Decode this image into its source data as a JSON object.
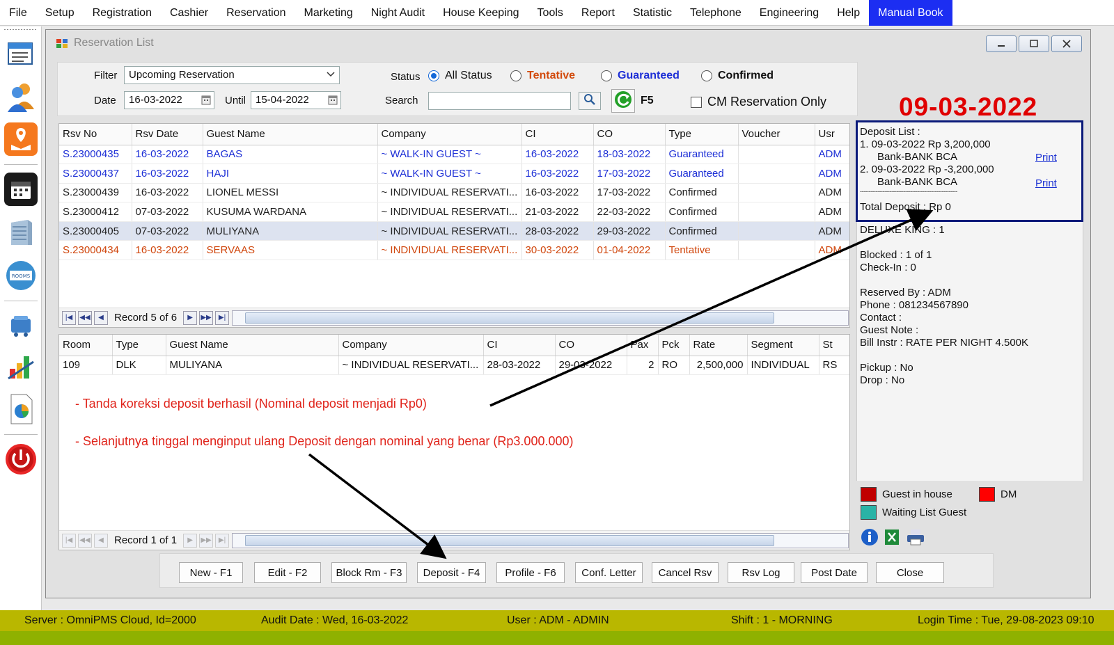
{
  "menu": [
    "File",
    "Setup",
    "Registration",
    "Cashier",
    "Reservation",
    "Marketing",
    "Night Audit",
    "House Keeping",
    "Tools",
    "Report",
    "Statistic",
    "Telephone",
    "Engineering",
    "Help",
    "Manual Book"
  ],
  "window": {
    "title": "Reservation List"
  },
  "filter": {
    "filter_label": "Filter",
    "filter_value": "Upcoming Reservation",
    "date_label": "Date",
    "date_value": "16-03-2022",
    "until_label": "Until",
    "until_value": "15-04-2022",
    "status_label": "Status",
    "status_options": [
      "All Status",
      "Tentative",
      "Guaranteed",
      "Confirmed"
    ],
    "status_selected": "All Status",
    "search_label": "Search",
    "search_value": "",
    "refresh_label": "F5",
    "cm_only_label": "CM Reservation Only"
  },
  "reservations": {
    "columns": [
      "Rsv No",
      "Rsv Date",
      "Guest Name",
      "Company",
      "CI",
      "CO",
      "Type",
      "Voucher",
      "Usr"
    ],
    "rows": [
      {
        "style": "blue",
        "cells": [
          "S.23000435",
          "16-03-2022",
          "BAGAS",
          "~ WALK-IN GUEST ~",
          "16-03-2022",
          "18-03-2022",
          "Guaranteed",
          "",
          "ADM"
        ]
      },
      {
        "style": "blue",
        "cells": [
          "S.23000437",
          "16-03-2022",
          "HAJI",
          "~ WALK-IN GUEST ~",
          "16-03-2022",
          "17-03-2022",
          "Guaranteed",
          "",
          "ADM"
        ]
      },
      {
        "style": "black",
        "cells": [
          "S.23000439",
          "16-03-2022",
          "LIONEL MESSI",
          "~ INDIVIDUAL RESERVATI...",
          "16-03-2022",
          "17-03-2022",
          "Confirmed",
          "",
          "ADM"
        ]
      },
      {
        "style": "black",
        "cells": [
          "S.23000412",
          "07-03-2022",
          "KUSUMA WARDANA",
          "~ INDIVIDUAL RESERVATI...",
          "21-03-2022",
          "22-03-2022",
          "Confirmed",
          "",
          "ADM"
        ]
      },
      {
        "style": "black sel",
        "cells": [
          "S.23000405",
          "07-03-2022",
          "MULIYANA",
          "~ INDIVIDUAL RESERVATI...",
          "28-03-2022",
          "29-03-2022",
          "Confirmed",
          "",
          "ADM"
        ]
      },
      {
        "style": "orange",
        "cells": [
          "S.23000434",
          "16-03-2022",
          "SERVAAS",
          "~ INDIVIDUAL RESERVATI...",
          "30-03-2022",
          "01-04-2022",
          "Tentative",
          "",
          "ADM"
        ]
      }
    ],
    "record_text": "Record 5 of 6"
  },
  "rooms": {
    "columns": [
      "Room",
      "Type",
      "Guest Name",
      "Company",
      "CI",
      "CO",
      "Pax",
      "Pck",
      "Rate",
      "Segment",
      "St"
    ],
    "rows": [
      {
        "cells": [
          "109",
          "DLK",
          "MULIYANA",
          "~ INDIVIDUAL RESERVATI...",
          "28-03-2022",
          "29-03-2022",
          "2",
          "RO",
          "2,500,000",
          "INDIVIDUAL",
          "RS"
        ]
      }
    ],
    "record_text": "Record 1 of 1"
  },
  "big_date": "09-03-2022",
  "deposit": {
    "title": "Deposit List :",
    "line1": "1. 09-03-2022   Rp 3,200,000",
    "line1b": "Bank-BANK BCA",
    "line2": "2. 09-03-2022   Rp -3,200,000",
    "line2b": "Bank-BANK BCA",
    "print_label": "Print",
    "dashes": "--------------------------------------------------------",
    "total": "Total Deposit : Rp 0"
  },
  "info": {
    "room_type": "DELUXE KING : 1",
    "blocked": "Blocked : 1 of 1",
    "checkin": "Check-In : 0",
    "reserved_by": "Reserved By : ADM",
    "phone": "Phone : 081234567890",
    "contact": "Contact :",
    "guest_note": "Guest Note :",
    "bill_instr": "Bill Instr : RATE PER NIGHT 4.500K",
    "pickup": "Pickup : No",
    "drop": "Drop : No"
  },
  "legend": {
    "guest_in_house": "Guest in house",
    "dm": "DM",
    "waiting_list": "Waiting List Guest",
    "colors": {
      "guest_in_house": "#c00000",
      "dm": "#ff0000",
      "waiting_list": "#2ab3a6"
    }
  },
  "annotations": {
    "note1": "- Tanda koreksi deposit berhasil (Nominal deposit menjadi Rp0)",
    "note2": "- Selanjutnya tinggal menginput ulang Deposit dengan nominal yang benar (Rp3.000.000)"
  },
  "buttons": [
    "New - F1",
    "Edit - F2",
    "Block Rm - F3",
    "Deposit - F4",
    "Profile  - F6",
    "Conf. Letter",
    "Cancel Rsv",
    "Rsv Log",
    "Post Date",
    "Close"
  ],
  "status_bar": {
    "server": "Server : OmniPMS Cloud, Id=2000",
    "audit_date": "Audit Date : Wed, 16-03-2022",
    "user": "User : ADM - ADMIN",
    "shift": "Shift : 1 - MORNING",
    "login_time": "Login Time : Tue, 29-08-2023 09:10"
  }
}
